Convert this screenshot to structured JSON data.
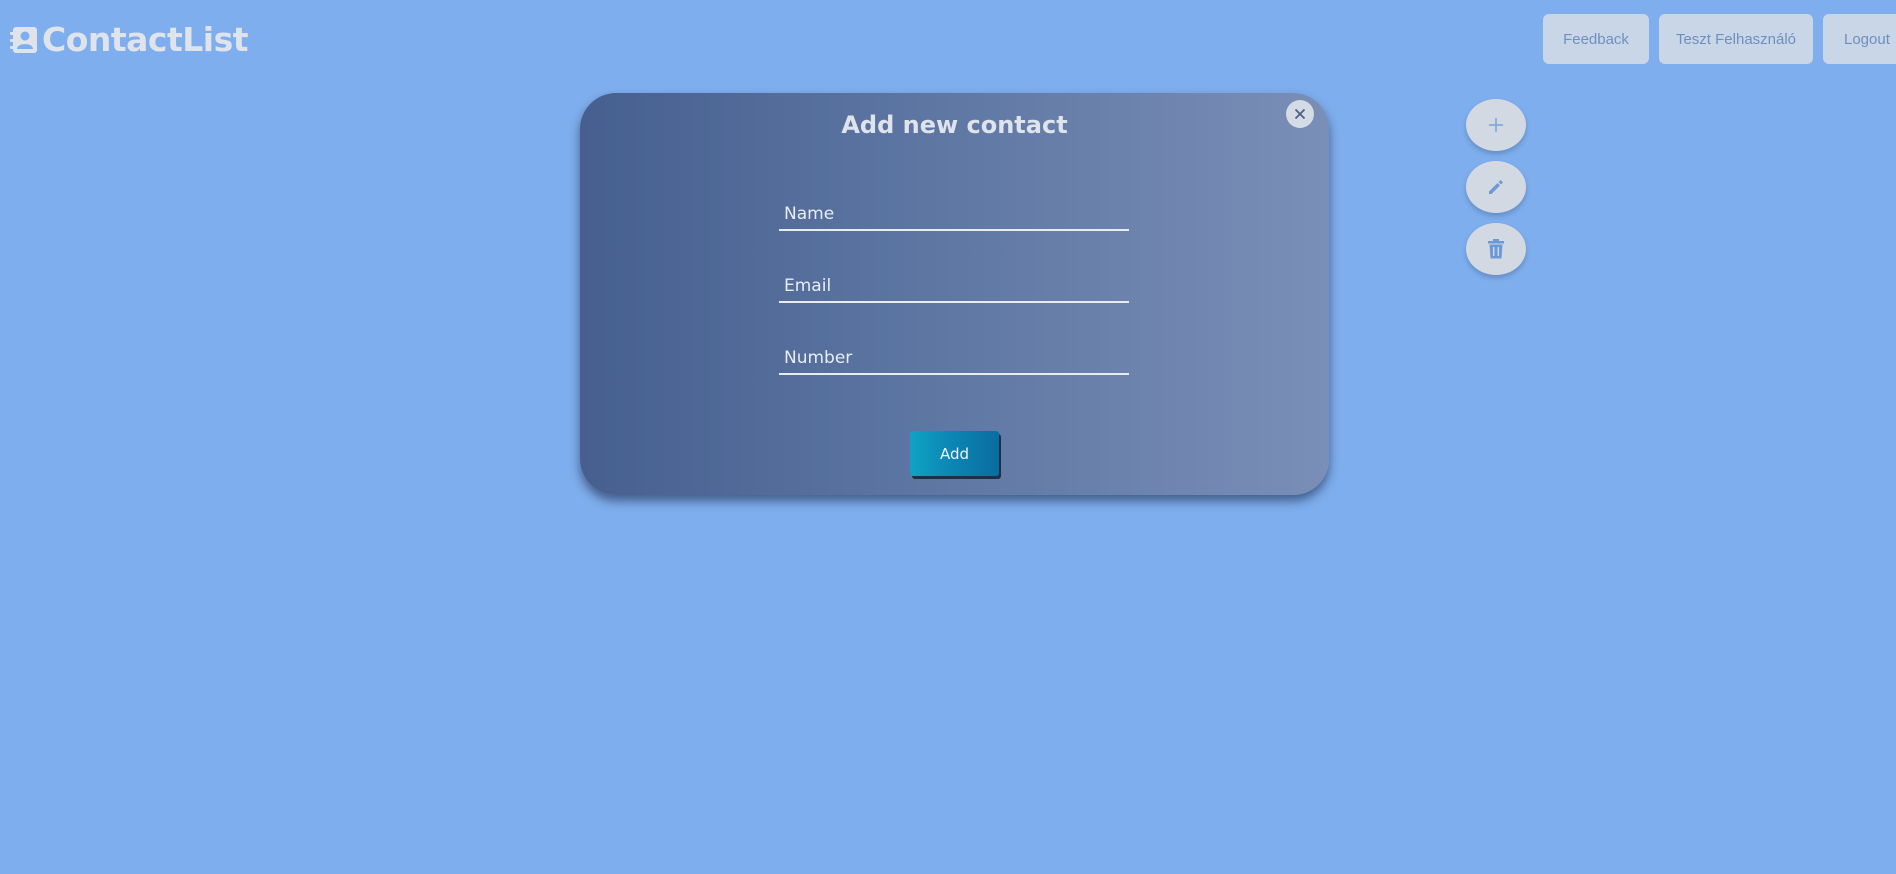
{
  "app": {
    "title": "ContactList",
    "logo_icon": "contact-card-icon"
  },
  "nav": {
    "feedback": "Feedback",
    "user": "Teszt Felhasználó",
    "logout": "Logout"
  },
  "actions": [
    {
      "name": "add",
      "icon": "plus-icon"
    },
    {
      "name": "edit",
      "icon": "pencil-icon"
    },
    {
      "name": "delete",
      "icon": "trash-icon"
    }
  ],
  "modal": {
    "title": "Add new contact",
    "close_icon": "close-icon",
    "fields": {
      "name": {
        "placeholder": "Name",
        "value": ""
      },
      "email": {
        "placeholder": "Email",
        "value": ""
      },
      "number": {
        "placeholder": "Number",
        "value": ""
      }
    },
    "submit_label": "Add"
  },
  "colors": {
    "background": "#7eaeed",
    "nav_button": "#c9d6e8",
    "nav_text": "#6f8fbf",
    "modal_gradient_start": "#465f8f",
    "modal_gradient_end": "#7a8fb7",
    "add_button": "#0b84b3"
  }
}
